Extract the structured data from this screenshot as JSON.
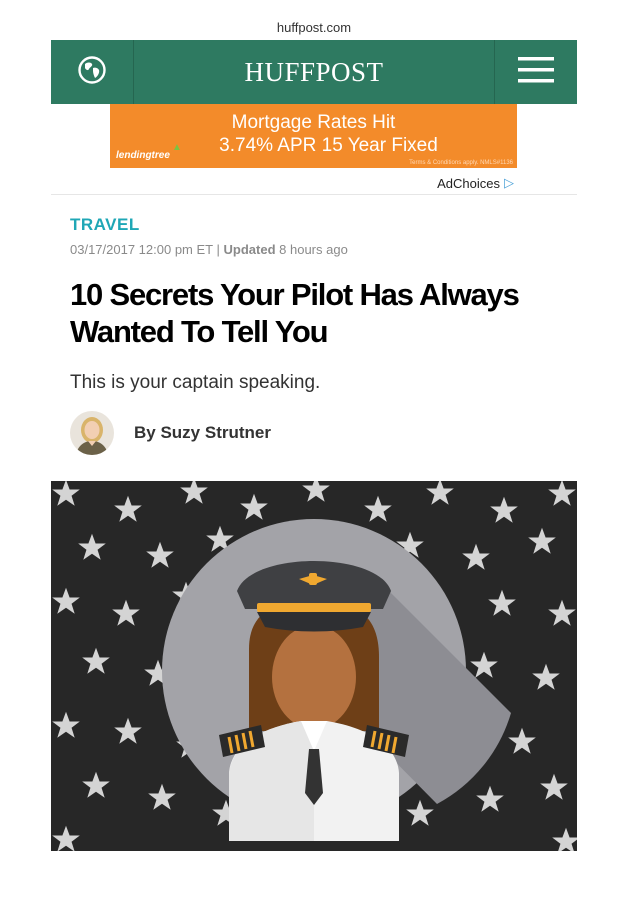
{
  "browser": {
    "url": "huffpost.com"
  },
  "header": {
    "logo": "HUFFPOST",
    "left_icon": "globe-icon",
    "right_icon": "hamburger-menu-icon",
    "bg_color": "#2e7a61"
  },
  "ad": {
    "line1": "Mortgage Rates Hit",
    "line2": "3.74% APR 15 Year Fixed",
    "brand": "lendingtree",
    "terms": "Terms & Conditions apply. NMLS#1136",
    "bg_color": "#f38b2a"
  },
  "adchoices": {
    "label": "AdChoices",
    "icon": "adchoices-icon"
  },
  "article": {
    "section": "TRAVEL",
    "date": "03/17/2017 12:00 pm ET",
    "separator": "|",
    "updated_label": "Updated",
    "updated_time": "8 hours ago",
    "headline": "10 Secrets Your Pilot Has Always Wanted To Tell You",
    "subhead": "This is your captain speaking.",
    "byline": "By Suzy Strutner",
    "section_color": "#1fa7b6"
  }
}
